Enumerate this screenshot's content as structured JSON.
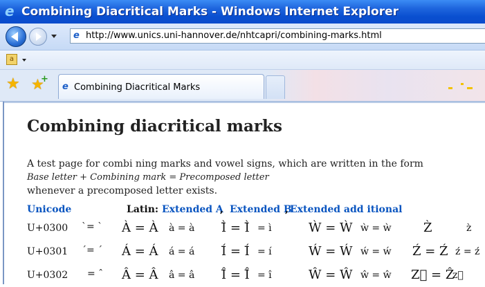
{
  "window": {
    "title": "Combining Diacritical Marks - Windows Internet Explorer"
  },
  "navigation": {
    "address_url": "http://www.unics.uni-hannover.de/nhtcapri/combining-marks.html"
  },
  "icons": {
    "app": "internet-explorer-icon",
    "back": "back-arrow-icon",
    "forward": "forward-arrow-icon",
    "page": "page-icon",
    "translate": "translate-icon",
    "favorites": "favorites-star-icon",
    "add_favorite": "add-favorite-icon"
  },
  "tabs": [
    {
      "label": "Combining Diacritical Marks"
    }
  ],
  "page": {
    "heading": "Combining diacritical marks",
    "intro_line1": "A test page for combi  ning marks and vowel signs, which are written in the form",
    "intro_line2": "Base letter + Combining mark = Precomposed letter",
    "intro_line3": "whenever a precomposed letter exists.",
    "nav": {
      "unicode": "Unicode",
      "latin": "Latin:",
      "extended_a": "Extended A",
      "sep1": ",",
      "extended_b": "Extended B",
      "sep2": ",",
      "extended_additional": "Extended add itional"
    },
    "rows": [
      {
        "code": "U+0300",
        "mark": "`= `",
        "c1": "À = À",
        "c2": "à = à",
        "c3": "Ì̄ = Ì̄",
        "c4": "= ì",
        "c5": "Ẁ = Ẁ",
        "c6": "ẁ = ẁ",
        "c7": "Z̀",
        "c8": "z̀"
      },
      {
        "code": "U+0301",
        "mark": "´= ´",
        "c1": "Á = Á",
        "c2": "á = á",
        "c3": "Í̄ = Í̄",
        "c4": "= í",
        "c5": "Ẃ = Ẃ",
        "c6": "ẃ = ẃ",
        "c7": "Ź = Ź",
        "c8": "ź = ź"
      },
      {
        "code": "U+0302",
        "mark": "= ˆ",
        "c1": "Â = Â",
        "c2": "â = â",
        "c3": "Î̄ = Î̄",
        "c4": "= î",
        "c5": "Ŵ = Ŵ",
        "c6": "ŵ = ŵ",
        "c7": "Z⃞ = Ẑ",
        "c8": "z⃞"
      }
    ]
  }
}
